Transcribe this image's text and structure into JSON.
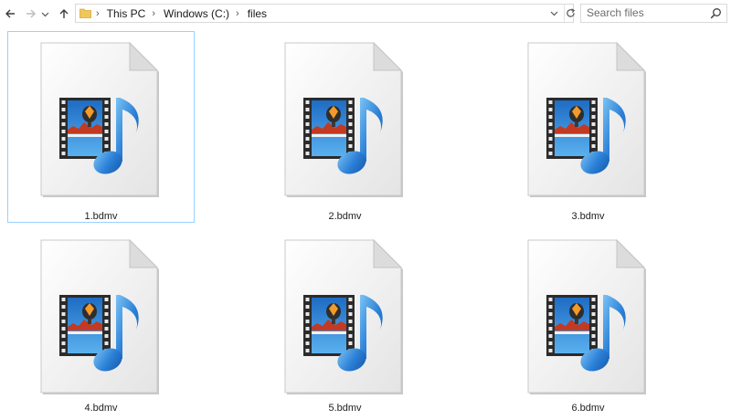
{
  "window": {
    "title": "files"
  },
  "toolbar": {
    "back": "back-arrow-icon",
    "forward": "forward-arrow-icon",
    "recent": "chevron-down-icon",
    "up": "up-arrow-icon"
  },
  "address": {
    "crumbs": [
      "This PC",
      "Windows (C:)",
      "files"
    ],
    "refresh_icon": "refresh-icon",
    "dropdown_icon": "chevron-down-icon"
  },
  "search": {
    "placeholder": "Search files",
    "icon": "search-icon"
  },
  "files": [
    {
      "name": "1.bdmv",
      "selected": true
    },
    {
      "name": "2.bdmv",
      "selected": false
    },
    {
      "name": "3.bdmv",
      "selected": false
    },
    {
      "name": "4.bdmv",
      "selected": false
    },
    {
      "name": "5.bdmv",
      "selected": false
    },
    {
      "name": "6.bdmv",
      "selected": false
    }
  ],
  "colors": {
    "selection_border": "#99d1ff",
    "note_blue": "#2a7fd6",
    "film_dark": "#2b2b2b",
    "sky_blue": "#2d8fd8",
    "folder_yellow": "#f0c75a"
  }
}
